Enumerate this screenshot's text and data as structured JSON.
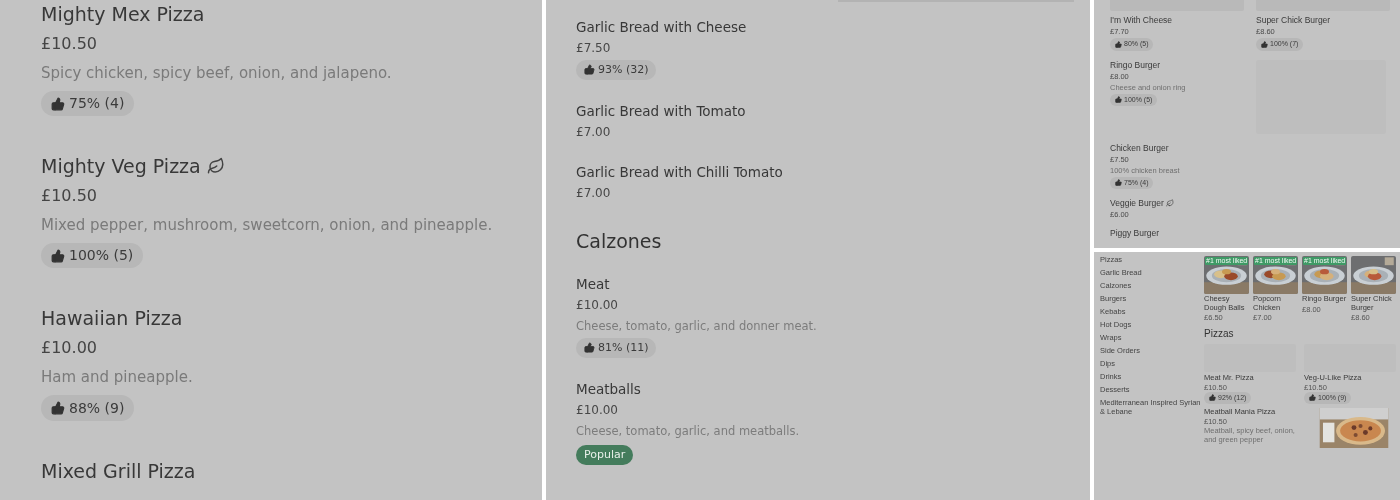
{
  "panels": [
    {
      "kind": "list",
      "items": [
        {
          "name": "Mighty Mex Pizza",
          "vegetarian": false,
          "price": "£10.50",
          "description": "Spicy chicken, spicy beef, onion, and jalapeno.",
          "rating": "75% (4)"
        },
        {
          "name": "Mighty Veg Pizza",
          "vegetarian": true,
          "price": "£10.50",
          "description": "Mixed pepper, mushroom, sweetcorn, onion, and pineapple.",
          "rating": "100% (5)"
        },
        {
          "name": "Hawaiian Pizza",
          "vegetarian": false,
          "price": "£10.00",
          "description": "Ham and pineapple.",
          "rating": "88% (9)"
        },
        {
          "name": "Mixed Grill Pizza",
          "vegetarian": false
        }
      ]
    },
    {
      "kind": "sections",
      "sections": [
        {
          "items": [
            {
              "name": "Garlic Bread with Cheese",
              "price": "£7.50",
              "rating": "93% (32)"
            },
            {
              "name": "Garlic Bread with Tomato",
              "price": "£7.00"
            },
            {
              "name": "Garlic Bread with Chilli Tomato",
              "price": "£7.00"
            }
          ]
        },
        {
          "heading": "Calzones",
          "items": [
            {
              "name": "Meat",
              "price": "£10.00",
              "description": "Cheese, tomato, garlic, and donner meat.",
              "rating": "81% (11)"
            },
            {
              "name": "Meatballs",
              "price": "£10.00",
              "description": "Cheese, tomato, garlic, and meatballs.",
              "badge": "Popular"
            }
          ]
        }
      ]
    },
    {
      "kind": "grid",
      "rows": [
        {
          "cells": [
            {
              "kind": "item",
              "image": true,
              "name": "I'm With Cheese",
              "price": "£7.70",
              "rating": "80% (5)"
            },
            {
              "kind": "item",
              "image": true,
              "name": "Super Chick Burger",
              "price": "£8.60",
              "rating": "100% (7)"
            }
          ]
        },
        {
          "cells": [
            {
              "kind": "item",
              "name": "Ringo Burger",
              "price": "£8.00",
              "description": "Cheese and onion ring",
              "rating": "100% (5)"
            },
            {
              "kind": "placeholder"
            }
          ]
        },
        {
          "cells": [
            {
              "kind": "item",
              "name": "Chicken Burger",
              "price": "£7.50",
              "description": "100% chicken breast",
              "rating": "75% (4)"
            }
          ]
        },
        {
          "cells": [
            {
              "kind": "item",
              "name": "Veggie Burger",
              "vegetarian": true,
              "price": "£6.00"
            }
          ]
        },
        {
          "cells": [
            {
              "kind": "item",
              "name": "Piggy Burger"
            }
          ]
        }
      ]
    },
    {
      "kind": "store",
      "categories": [
        "Pizzas",
        "Garlic Bread",
        "Calzones",
        "Burgers",
        "Kebabs",
        "Hot Dogs",
        "Wraps",
        "Side Orders",
        "Dips",
        "Drinks",
        "Desserts",
        "Mediterranean Inspired Syrian & Lebane"
      ],
      "featured": [
        {
          "name": "Cheesy Dough Balls",
          "price": "£6.50",
          "badge": "#1 most liked"
        },
        {
          "name": "Popcorn Chicken",
          "price": "£7.00",
          "badge": "#1 most liked"
        },
        {
          "name": "Ringo Burger",
          "price": "£8.00",
          "badge": "#1 most liked"
        },
        {
          "name": "Super Chick Burger",
          "price": "£8.60"
        }
      ],
      "heading": "Pizzas",
      "items": [
        {
          "kind": "placeholder_card",
          "name": "Meat Mr. Pizza",
          "price": "£10.50",
          "rating": "92% (12)"
        },
        {
          "kind": "placeholder_card",
          "name": "Veg-U-Like Pizza",
          "price": "£10.50",
          "rating": "100% (9)"
        },
        {
          "kind": "photo_row",
          "name": "Meatball Mania Pizza",
          "price": "£10.50",
          "description": "Meatball, spicy beef, onion, and green pepper"
        }
      ]
    }
  ]
}
